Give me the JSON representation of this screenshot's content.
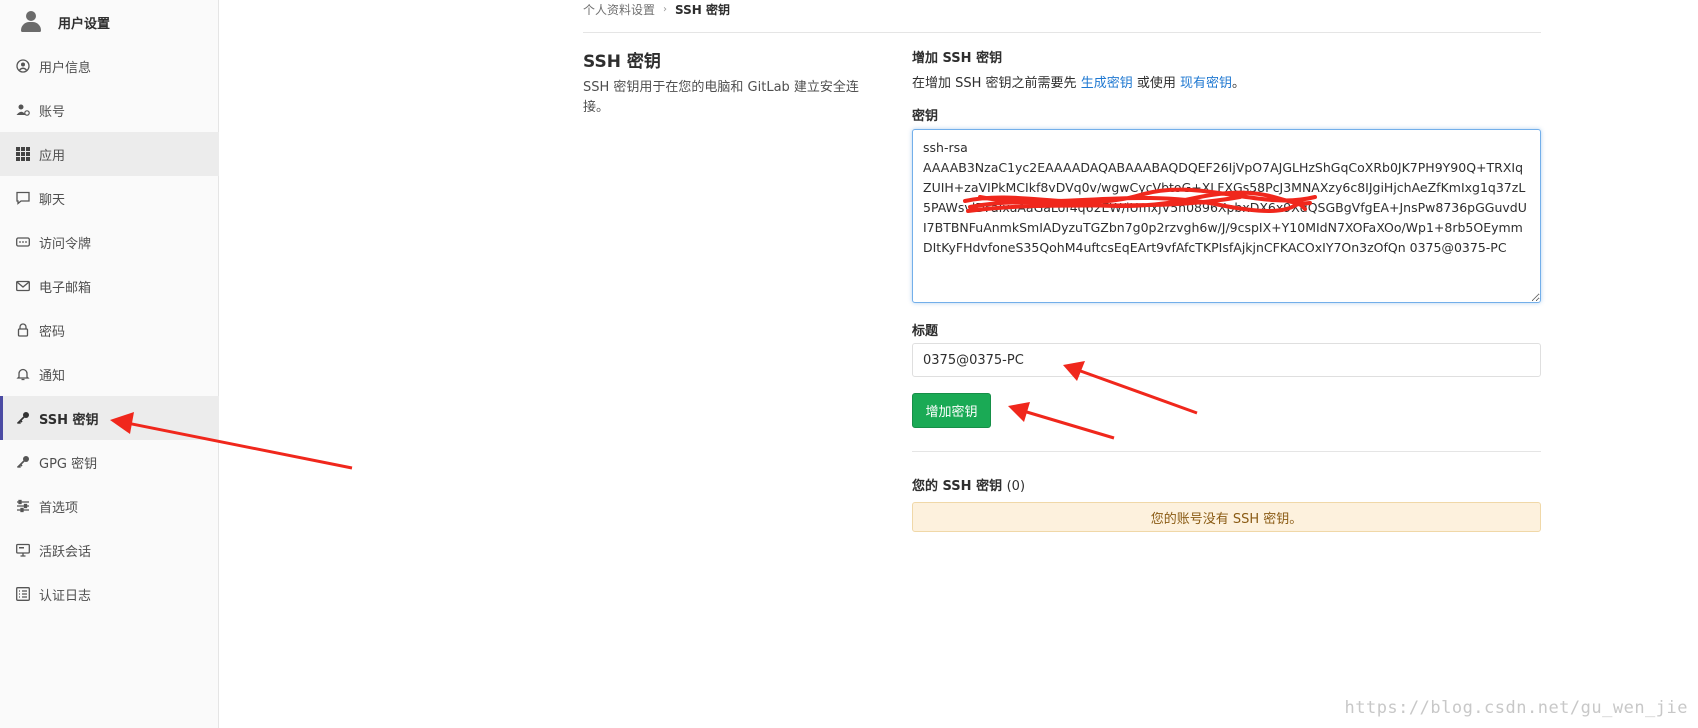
{
  "sidebar": {
    "title": "用户设置",
    "items": [
      {
        "label": "用户信息",
        "icon": "user-circle-icon"
      },
      {
        "label": "账号",
        "icon": "user-gear-icon"
      },
      {
        "label": "应用",
        "icon": "grid-icon"
      },
      {
        "label": "聊天",
        "icon": "chat-bubble-icon"
      },
      {
        "label": "访问令牌",
        "icon": "token-icon"
      },
      {
        "label": "电子邮箱",
        "icon": "envelope-icon"
      },
      {
        "label": "密码",
        "icon": "lock-icon"
      },
      {
        "label": "通知",
        "icon": "bell-icon"
      },
      {
        "label": "SSH 密钥",
        "icon": "key-icon"
      },
      {
        "label": "GPG 密钥",
        "icon": "key-icon"
      },
      {
        "label": "首选项",
        "icon": "sliders-icon"
      },
      {
        "label": "活跃会话",
        "icon": "monitor-icon"
      },
      {
        "label": "认证日志",
        "icon": "list-icon"
      }
    ]
  },
  "breadcrumb": {
    "parent": "个人资料设置",
    "current": "SSH 密钥"
  },
  "section": {
    "title": "SSH 密钥",
    "description": "SSH 密钥用于在您的电脑和 GitLab 建立安全连接。"
  },
  "form": {
    "heading": "增加 SSH 密钥",
    "hint_prefix": "在增加 SSH 密钥之前需要先",
    "hint_link1": "生成密钥",
    "hint_middle": "或使用",
    "hint_link2": "现有密钥",
    "hint_suffix": "。",
    "key_label": "密钥",
    "key_value": "ssh-rsa\nAAAAB3NzaC1yc2EAAAADAQABAAABAQDQEF26IjVpO7AJGLHzShGqCoXRb0JK7PH9Y90Q+TRXIqZUIH+zaVIPkMCIkf8vDVq0v/wgwCycVbtoG+XLFXGs58PcJ3MNAXzy6c8IJgiHjchAeZfKmIxg1q37zL5PAWsvlDFaIxaAaGaLof4q62EW/iUmxjV5n0896XpbxDX6x9XdQSGBgVfgEA+JnsPw8736pGGuvdUI7BTBNFuAnmkSmIADyzuTGZbn7g0p2rzvgh6w/J/9cspIX+Y10MIdN7XOFaXOo/Wp1+8rb5OEymmDItKyFHdvfoneS35QohM4uftcsEqEArt9vfAfcTKPIsfAjkjnCFKACOxIY7On3zOfQn 0375@0375-PC",
    "title_label": "标题",
    "title_value": "0375@0375-PC",
    "submit_label": "增加密钥"
  },
  "keys": {
    "heading": "您的 SSH 密钥",
    "count": "(0)",
    "empty_message": "您的账号没有 SSH 密钥。"
  },
  "watermark": "https://blog.csdn.net/gu_wen_jie",
  "colors": {
    "primary_button": "#1aaa55",
    "link": "#1f78d1",
    "active_nav_bar": "#4b4ba3",
    "annotation_red": "#f0271c",
    "warning_bg": "#fdf1dd"
  }
}
